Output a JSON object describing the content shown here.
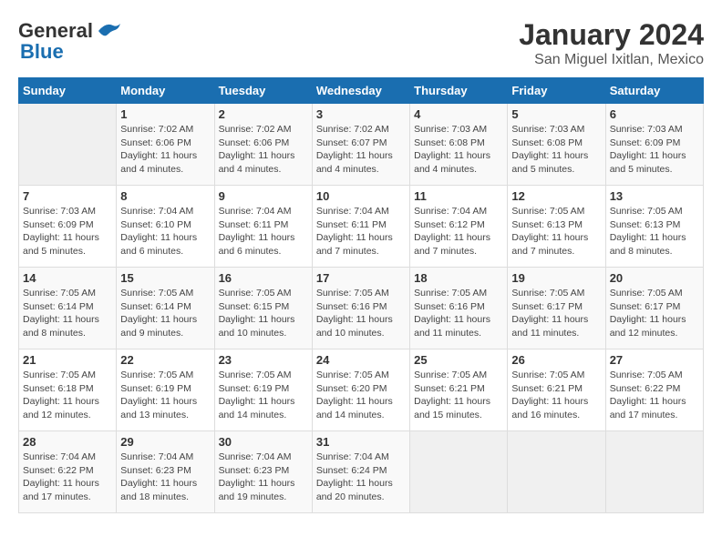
{
  "header": {
    "logo": {
      "line1": "General",
      "line2": "Blue"
    },
    "title": "January 2024",
    "subtitle": "San Miguel Ixitlan, Mexico"
  },
  "days_of_week": [
    "Sunday",
    "Monday",
    "Tuesday",
    "Wednesday",
    "Thursday",
    "Friday",
    "Saturday"
  ],
  "weeks": [
    [
      {
        "day": "",
        "sunrise": "",
        "sunset": "",
        "daylight": ""
      },
      {
        "day": "1",
        "sunrise": "Sunrise: 7:02 AM",
        "sunset": "Sunset: 6:06 PM",
        "daylight": "Daylight: 11 hours and 4 minutes."
      },
      {
        "day": "2",
        "sunrise": "Sunrise: 7:02 AM",
        "sunset": "Sunset: 6:06 PM",
        "daylight": "Daylight: 11 hours and 4 minutes."
      },
      {
        "day": "3",
        "sunrise": "Sunrise: 7:02 AM",
        "sunset": "Sunset: 6:07 PM",
        "daylight": "Daylight: 11 hours and 4 minutes."
      },
      {
        "day": "4",
        "sunrise": "Sunrise: 7:03 AM",
        "sunset": "Sunset: 6:08 PM",
        "daylight": "Daylight: 11 hours and 4 minutes."
      },
      {
        "day": "5",
        "sunrise": "Sunrise: 7:03 AM",
        "sunset": "Sunset: 6:08 PM",
        "daylight": "Daylight: 11 hours and 5 minutes."
      },
      {
        "day": "6",
        "sunrise": "Sunrise: 7:03 AM",
        "sunset": "Sunset: 6:09 PM",
        "daylight": "Daylight: 11 hours and 5 minutes."
      }
    ],
    [
      {
        "day": "7",
        "sunrise": "Sunrise: 7:03 AM",
        "sunset": "Sunset: 6:09 PM",
        "daylight": "Daylight: 11 hours and 5 minutes."
      },
      {
        "day": "8",
        "sunrise": "Sunrise: 7:04 AM",
        "sunset": "Sunset: 6:10 PM",
        "daylight": "Daylight: 11 hours and 6 minutes."
      },
      {
        "day": "9",
        "sunrise": "Sunrise: 7:04 AM",
        "sunset": "Sunset: 6:11 PM",
        "daylight": "Daylight: 11 hours and 6 minutes."
      },
      {
        "day": "10",
        "sunrise": "Sunrise: 7:04 AM",
        "sunset": "Sunset: 6:11 PM",
        "daylight": "Daylight: 11 hours and 7 minutes."
      },
      {
        "day": "11",
        "sunrise": "Sunrise: 7:04 AM",
        "sunset": "Sunset: 6:12 PM",
        "daylight": "Daylight: 11 hours and 7 minutes."
      },
      {
        "day": "12",
        "sunrise": "Sunrise: 7:05 AM",
        "sunset": "Sunset: 6:13 PM",
        "daylight": "Daylight: 11 hours and 7 minutes."
      },
      {
        "day": "13",
        "sunrise": "Sunrise: 7:05 AM",
        "sunset": "Sunset: 6:13 PM",
        "daylight": "Daylight: 11 hours and 8 minutes."
      }
    ],
    [
      {
        "day": "14",
        "sunrise": "Sunrise: 7:05 AM",
        "sunset": "Sunset: 6:14 PM",
        "daylight": "Daylight: 11 hours and 8 minutes."
      },
      {
        "day": "15",
        "sunrise": "Sunrise: 7:05 AM",
        "sunset": "Sunset: 6:14 PM",
        "daylight": "Daylight: 11 hours and 9 minutes."
      },
      {
        "day": "16",
        "sunrise": "Sunrise: 7:05 AM",
        "sunset": "Sunset: 6:15 PM",
        "daylight": "Daylight: 11 hours and 10 minutes."
      },
      {
        "day": "17",
        "sunrise": "Sunrise: 7:05 AM",
        "sunset": "Sunset: 6:16 PM",
        "daylight": "Daylight: 11 hours and 10 minutes."
      },
      {
        "day": "18",
        "sunrise": "Sunrise: 7:05 AM",
        "sunset": "Sunset: 6:16 PM",
        "daylight": "Daylight: 11 hours and 11 minutes."
      },
      {
        "day": "19",
        "sunrise": "Sunrise: 7:05 AM",
        "sunset": "Sunset: 6:17 PM",
        "daylight": "Daylight: 11 hours and 11 minutes."
      },
      {
        "day": "20",
        "sunrise": "Sunrise: 7:05 AM",
        "sunset": "Sunset: 6:17 PM",
        "daylight": "Daylight: 11 hours and 12 minutes."
      }
    ],
    [
      {
        "day": "21",
        "sunrise": "Sunrise: 7:05 AM",
        "sunset": "Sunset: 6:18 PM",
        "daylight": "Daylight: 11 hours and 12 minutes."
      },
      {
        "day": "22",
        "sunrise": "Sunrise: 7:05 AM",
        "sunset": "Sunset: 6:19 PM",
        "daylight": "Daylight: 11 hours and 13 minutes."
      },
      {
        "day": "23",
        "sunrise": "Sunrise: 7:05 AM",
        "sunset": "Sunset: 6:19 PM",
        "daylight": "Daylight: 11 hours and 14 minutes."
      },
      {
        "day": "24",
        "sunrise": "Sunrise: 7:05 AM",
        "sunset": "Sunset: 6:20 PM",
        "daylight": "Daylight: 11 hours and 14 minutes."
      },
      {
        "day": "25",
        "sunrise": "Sunrise: 7:05 AM",
        "sunset": "Sunset: 6:21 PM",
        "daylight": "Daylight: 11 hours and 15 minutes."
      },
      {
        "day": "26",
        "sunrise": "Sunrise: 7:05 AM",
        "sunset": "Sunset: 6:21 PM",
        "daylight": "Daylight: 11 hours and 16 minutes."
      },
      {
        "day": "27",
        "sunrise": "Sunrise: 7:05 AM",
        "sunset": "Sunset: 6:22 PM",
        "daylight": "Daylight: 11 hours and 17 minutes."
      }
    ],
    [
      {
        "day": "28",
        "sunrise": "Sunrise: 7:04 AM",
        "sunset": "Sunset: 6:22 PM",
        "daylight": "Daylight: 11 hours and 17 minutes."
      },
      {
        "day": "29",
        "sunrise": "Sunrise: 7:04 AM",
        "sunset": "Sunset: 6:23 PM",
        "daylight": "Daylight: 11 hours and 18 minutes."
      },
      {
        "day": "30",
        "sunrise": "Sunrise: 7:04 AM",
        "sunset": "Sunset: 6:23 PM",
        "daylight": "Daylight: 11 hours and 19 minutes."
      },
      {
        "day": "31",
        "sunrise": "Sunrise: 7:04 AM",
        "sunset": "Sunset: 6:24 PM",
        "daylight": "Daylight: 11 hours and 20 minutes."
      },
      {
        "day": "",
        "sunrise": "",
        "sunset": "",
        "daylight": ""
      },
      {
        "day": "",
        "sunrise": "",
        "sunset": "",
        "daylight": ""
      },
      {
        "day": "",
        "sunrise": "",
        "sunset": "",
        "daylight": ""
      }
    ]
  ]
}
